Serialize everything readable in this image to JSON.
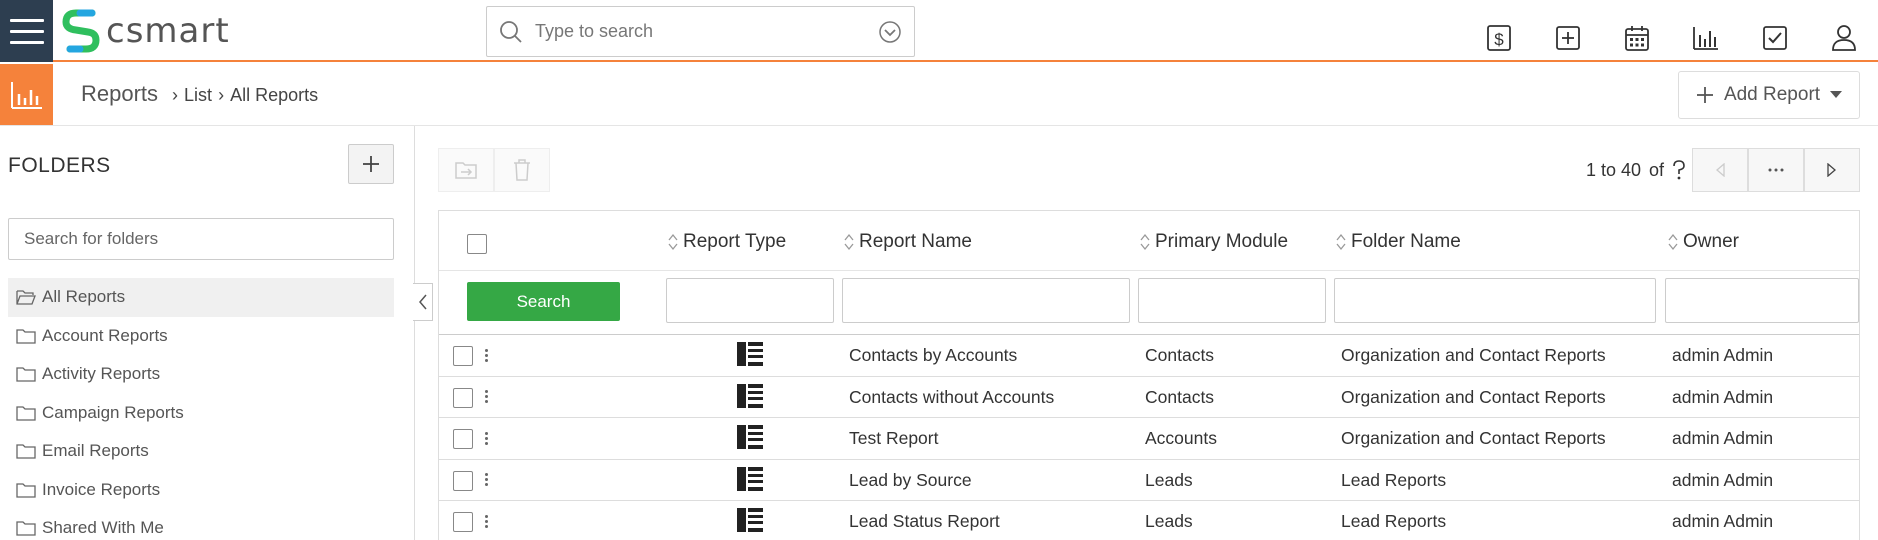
{
  "brand": {
    "name": "csmart",
    "accent": "#f5823b",
    "dark": "#2d3e50",
    "green": "#35a845"
  },
  "global_search": {
    "placeholder": "Type to search"
  },
  "top_icons": [
    "dollar-icon",
    "plus-square-icon",
    "calendar-icon",
    "bar-chart-icon",
    "checkbox-icon",
    "user-icon"
  ],
  "breadcrumb": {
    "module": "Reports",
    "items": [
      "List",
      "All Reports"
    ]
  },
  "add_report": {
    "label": "Add Report"
  },
  "sidebar": {
    "title": "FOLDERS",
    "search_placeholder": "Search for folders",
    "folders": [
      "All Reports",
      "Account Reports",
      "Activity Reports",
      "Campaign Reports",
      "Email Reports",
      "Invoice Reports",
      "Shared With Me"
    ],
    "active": "All Reports"
  },
  "pager": {
    "range": "1 to 40",
    "of": "of"
  },
  "table": {
    "columns": [
      "Report Type",
      "Report Name",
      "Primary Module",
      "Folder Name",
      "Owner"
    ],
    "search_label": "Search",
    "rows": [
      {
        "name": "Contacts by Accounts",
        "module": "Contacts",
        "folder": "Organization and Contact Reports",
        "owner": "admin Admin"
      },
      {
        "name": "Contacts without Accounts",
        "module": "Contacts",
        "folder": "Organization and Contact Reports",
        "owner": "admin Admin"
      },
      {
        "name": "Test Report",
        "module": "Accounts",
        "folder": "Organization and Contact Reports",
        "owner": "admin Admin"
      },
      {
        "name": "Lead by Source",
        "module": "Leads",
        "folder": "Lead Reports",
        "owner": "admin Admin"
      },
      {
        "name": "Lead Status Report",
        "module": "Leads",
        "folder": "Lead Reports",
        "owner": "admin Admin"
      }
    ]
  }
}
